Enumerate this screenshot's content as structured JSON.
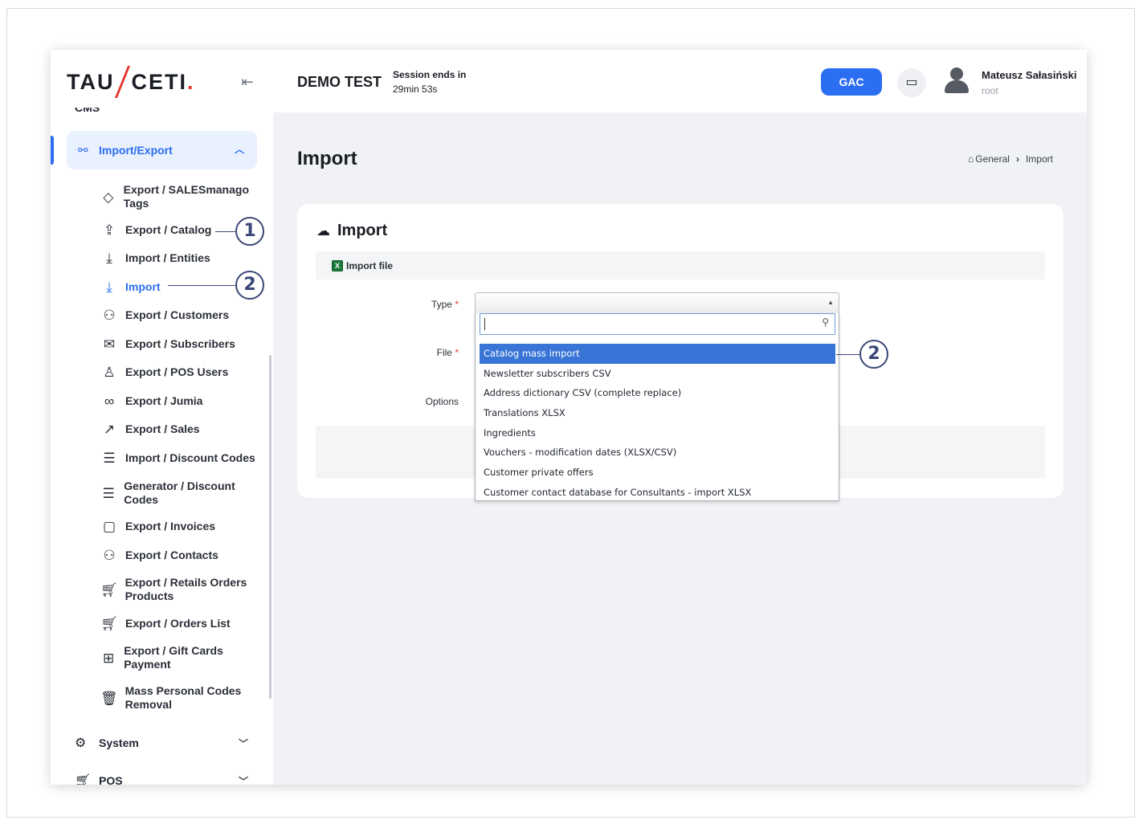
{
  "brand": {
    "part1": "TAU",
    "part2": "CETI",
    "dot": "."
  },
  "sidebar": {
    "cut_item": "CMS",
    "active_group": "Import/Export",
    "items": [
      {
        "label": "Export / SALESmanago Tags",
        "icon": "tag-icon"
      },
      {
        "label": "Export / Catalog",
        "icon": "upload-icon"
      },
      {
        "label": "Import / Entities",
        "icon": "download-icon"
      },
      {
        "label": "Import",
        "icon": "download-icon",
        "current": true
      },
      {
        "label": "Export / Customers",
        "icon": "users-icon"
      },
      {
        "label": "Export / Subscribers",
        "icon": "mail-icon"
      },
      {
        "label": "Export / POS Users",
        "icon": "user-icon"
      },
      {
        "label": "Export / Jumia",
        "icon": "link-icon"
      },
      {
        "label": "Export / Sales",
        "icon": "trend-icon"
      },
      {
        "label": "Import / Discount Codes",
        "icon": "list-icon"
      },
      {
        "label": "Generator / Discount Codes",
        "icon": "list-icon"
      },
      {
        "label": "Export / Invoices",
        "icon": "clipboard-icon"
      },
      {
        "label": "Export / Contacts",
        "icon": "users-icon"
      },
      {
        "label": "Export / Retails Orders Products",
        "icon": "cart-icon"
      },
      {
        "label": "Export / Orders List",
        "icon": "cart-icon"
      },
      {
        "label": "Export / Gift Cards Payment",
        "icon": "gift-icon"
      },
      {
        "label": "Mass Personal Codes Removal",
        "icon": "trash-icon"
      }
    ],
    "groups": [
      {
        "label": "System",
        "icon": "gear-icon"
      },
      {
        "label": "POS",
        "icon": "cart-icon"
      }
    ]
  },
  "header": {
    "env_title": "DEMO TEST",
    "session_label": "Session ends in",
    "session_time": "29min 53s",
    "gac_label": "GAC",
    "user_name": "Mateusz Sałasiński",
    "user_role": "root"
  },
  "page": {
    "title": "Import",
    "breadcrumb": [
      "General",
      "Import"
    ]
  },
  "card": {
    "title": "Import",
    "section": "Import file",
    "labels": {
      "type": "Type",
      "file": "File",
      "options": "Options",
      "required": "*"
    }
  },
  "dropdown": {
    "search_value": "",
    "options": [
      "Catalog mass import",
      "Newsletter subscribers CSV",
      "Address dictionary CSV (complete replace)",
      "Translations XLSX",
      "Ingredients",
      "Vouchers - modification dates (XLSX/CSV)",
      "Customer private offers",
      "Customer contact database for Consultants - import XLSX"
    ],
    "selected_index": 0
  },
  "callouts": [
    "1",
    "2",
    "2"
  ],
  "colors": {
    "accent": "#2b6ef2",
    "brand_red": "#e5322d",
    "selected": "#3875d7",
    "callout": "#3b4777"
  }
}
